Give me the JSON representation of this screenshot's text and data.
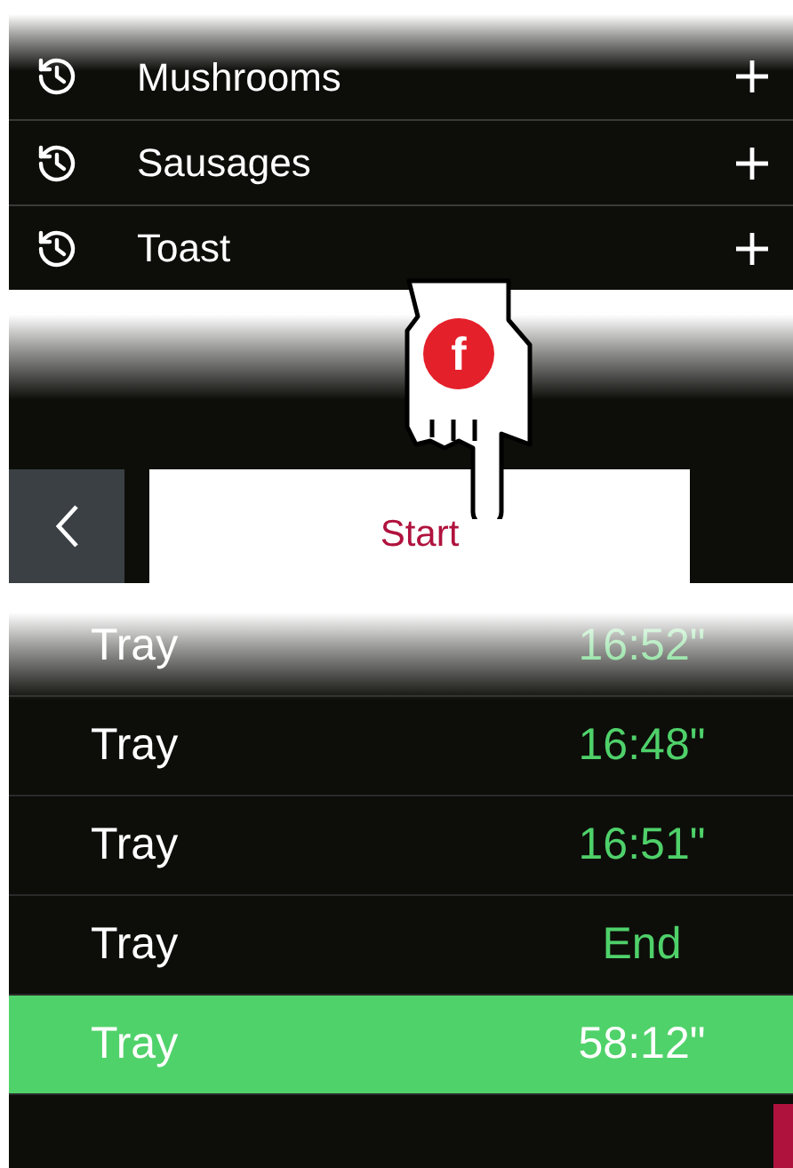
{
  "recent_list": {
    "items": [
      {
        "label": "Mushrooms"
      },
      {
        "label": "Sausages"
      },
      {
        "label": "Toast"
      }
    ]
  },
  "start_panel": {
    "start_label": "Start",
    "pointer_badge": "f"
  },
  "timer_list": {
    "rows": [
      {
        "label": "Tray",
        "time": "16:52\"",
        "selected": false
      },
      {
        "label": "Tray",
        "time": "16:48\"",
        "selected": false
      },
      {
        "label": "Tray",
        "time": "16:51\"",
        "selected": false
      },
      {
        "label": "Tray",
        "time": "End",
        "selected": false
      },
      {
        "label": "Tray",
        "time": "58:12\"",
        "selected": true
      }
    ]
  }
}
